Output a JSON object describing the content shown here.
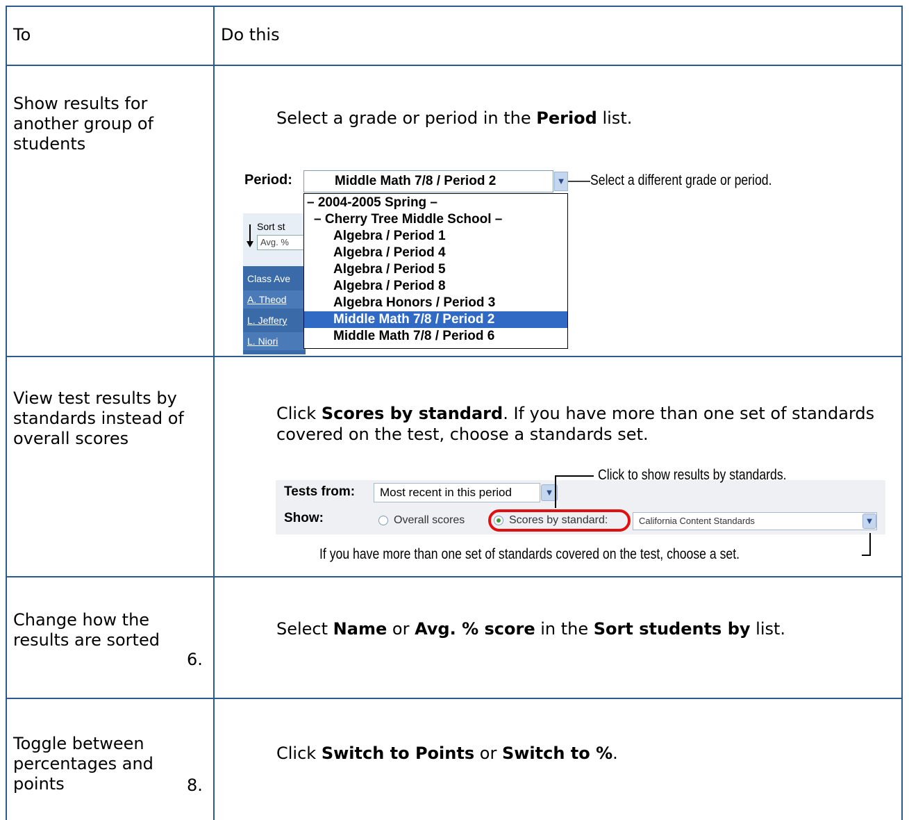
{
  "table": {
    "header": {
      "col1": "To",
      "col2": "Do this"
    },
    "rows": [
      {
        "to": "Show results for another group of students",
        "do_parts": [
          "Select a grade or period in the ",
          "Period",
          " list."
        ],
        "screenshot": {
          "period_label": "Period:",
          "selected": "Middle Math 7/8 / Period 2",
          "callout": "Select a different grade or period.",
          "options": [
            "– 2004-2005 Spring –",
            "– Cherry Tree Middle School –",
            "Algebra / Period 1",
            "Algebra / Period 4",
            "Algebra / Period 5",
            "Algebra / Period 8",
            "Algebra Honors / Period 3",
            "Middle Math 7/8 / Period 2",
            "Middle Math 7/8 / Period 6"
          ],
          "sort_fragment": "Sort st",
          "avg_fragment": "Avg. %",
          "side_rows": [
            "Class Ave",
            "A. Theod",
            "L. Jeffery",
            "L. Niori"
          ]
        }
      },
      {
        "to": "View test results by standards instead of overall scores",
        "do_parts": [
          "Click ",
          "Scores by standard",
          ". If you have more than one set of standards covered on the test, choose a standards set."
        ],
        "screenshot": {
          "tests_from_label": "Tests from:",
          "tests_from_value": "Most recent in this period",
          "show_label": "Show:",
          "overall_label": "Overall scores",
          "by_standard_label": "Scores by standard:",
          "standards_set": "California Content Standards",
          "callout_top": "Click to show results by standards.",
          "callout_bottom": "If you have more than one set of standards covered on the test, choose a set."
        }
      },
      {
        "to": "Change how the results are sorted",
        "step": "6.",
        "do_parts": [
          "Select ",
          "Name",
          " or ",
          "Avg. % score",
          " in the ",
          "Sort students by",
          " list."
        ]
      },
      {
        "to": "Toggle between percentages and points",
        "step": "8.",
        "do_parts": [
          "Click ",
          "Switch to Points",
          " or ",
          "Switch to %",
          "."
        ]
      }
    ]
  }
}
